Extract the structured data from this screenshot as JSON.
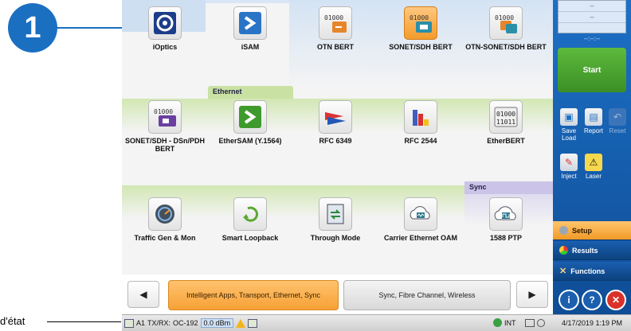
{
  "annotation": {
    "callout_number": "1",
    "status_label": "d'état"
  },
  "categories": {
    "ethernet": "Ethernet",
    "sync": "Sync"
  },
  "apps": [
    {
      "name": "iOptics",
      "icon": "ioptics-icon"
    },
    {
      "name": "iSAM",
      "icon": "isam-icon"
    },
    {
      "name": "OTN BERT",
      "icon": "otn-bert-icon"
    },
    {
      "name": "SONET/SDH BERT",
      "icon": "sonet-bert-icon",
      "selected": true
    },
    {
      "name": "OTN-SONET/SDH BERT",
      "icon": "otn-sonet-bert-icon"
    },
    {
      "name": "SONET/SDH - DSn/PDH BERT",
      "icon": "dsn-pdh-bert-icon"
    },
    {
      "name": "EtherSAM (Y.1564)",
      "icon": "ethersam-icon"
    },
    {
      "name": "RFC 6349",
      "icon": "rfc6349-icon"
    },
    {
      "name": "RFC 2544",
      "icon": "rfc2544-icon"
    },
    {
      "name": "EtherBERT",
      "icon": "etherbert-icon"
    },
    {
      "name": "Traffic Gen & Mon",
      "icon": "traffic-gen-icon"
    },
    {
      "name": "Smart Loopback",
      "icon": "smart-loopback-icon"
    },
    {
      "name": "Through Mode",
      "icon": "through-mode-icon"
    },
    {
      "name": "Carrier Ethernet OAM",
      "icon": "carrier-oam-icon"
    },
    {
      "name": "1588 PTP",
      "icon": "ptp-icon"
    }
  ],
  "bit_icon_text": {
    "line1": "01000",
    "line2": "11011"
  },
  "nav": {
    "prev": "◀",
    "next": "▶",
    "page1": "Intelligent Apps, Transport, Ethernet, Sync",
    "page2": "Sync, Fibre Channel, Wireless"
  },
  "status": {
    "port": "A1",
    "txrx": "TX/RX:",
    "rate": "OC-192",
    "power": "0.0 dBm",
    "clock": "INT",
    "datetime": "4/17/2019 1:19 PM"
  },
  "right_panel": {
    "readout_1": "--",
    "readout_2": "--",
    "time": "--:--:--",
    "start": "Start",
    "save_load": "Save Load",
    "report": "Report",
    "reset": "Reset",
    "inject": "Inject",
    "laser": "Laser",
    "setup": "Setup",
    "results": "Results",
    "functions": "Functions"
  },
  "colors": {
    "accent": "#f7a136",
    "panel_blue": "#1d70c6",
    "ethernet_green": "#c9e1a3",
    "sync_purple": "#cbc4e8"
  }
}
